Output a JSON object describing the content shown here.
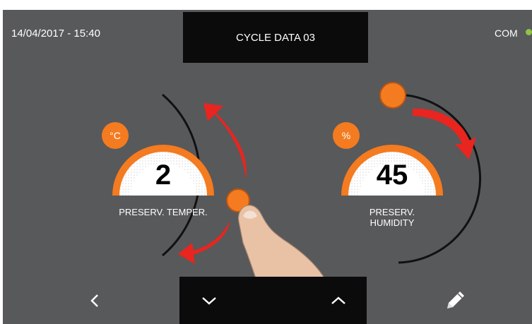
{
  "header": {
    "datetime": "14/04/2017 - 15:40",
    "title": "CYCLE DATA 03",
    "status_label": "COM",
    "status_color": "#8dc63f"
  },
  "gauges": [
    {
      "unit": "°C",
      "value": "2",
      "label_line1": "PRESERV. TEMPER.",
      "label_line2": ""
    },
    {
      "unit": "%",
      "value": "45",
      "label_line1": "PRESERV.",
      "label_line2": "HUMIDITY"
    }
  ],
  "colors": {
    "accent": "#f47b20",
    "arrow": "#e8251f",
    "background": "#58595b",
    "bar": "#0b0b0b"
  },
  "footer": {
    "icons": [
      "chevron-left-icon",
      "chevron-down-icon",
      "chevron-up-icon",
      "pencil-icon"
    ]
  }
}
